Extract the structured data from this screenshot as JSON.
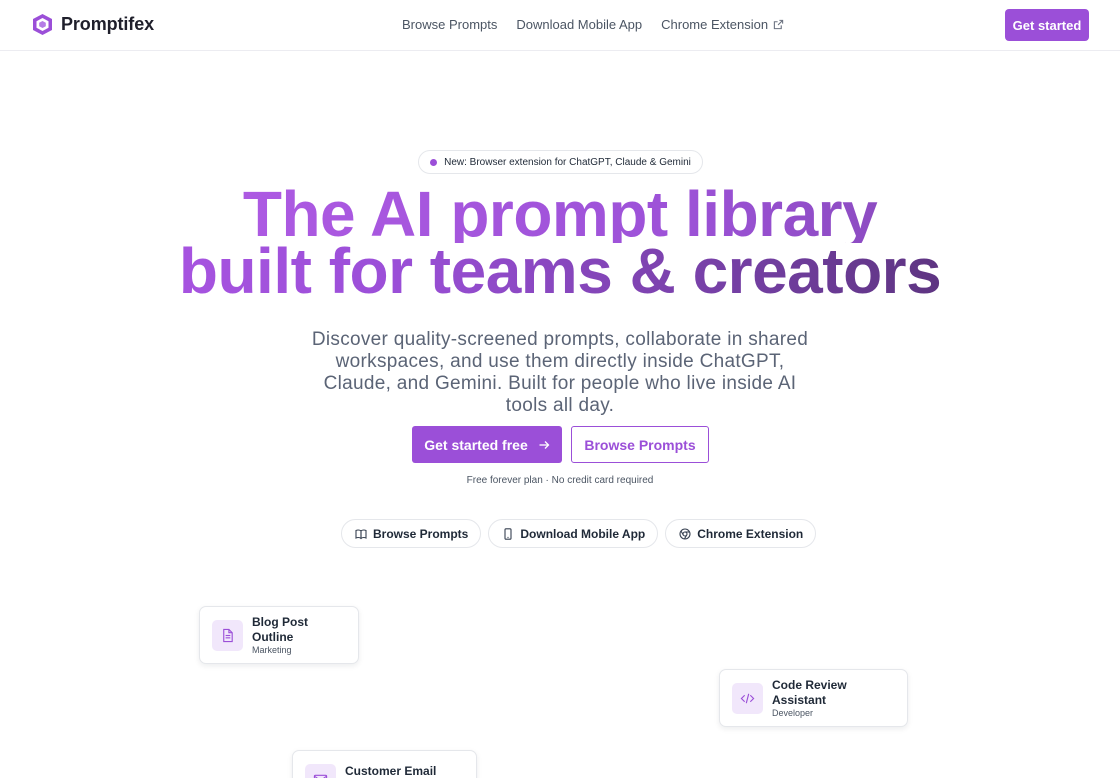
{
  "brand": {
    "name": "Promptifex",
    "accent": "#9b4fd8"
  },
  "nav": {
    "items": [
      {
        "label": "Browse Prompts"
      },
      {
        "label": "Download Mobile App"
      },
      {
        "label": "Chrome Extension",
        "icon": "external-link-icon"
      }
    ],
    "cta_label": "Get started"
  },
  "hero": {
    "badge": "New: Browser extension for ChatGPT, Claude & Gemini",
    "headline_line1": "The AI prompt library",
    "headline_line2": "built for teams & creators",
    "subtext": "Discover quality-screened prompts, collaborate in shared workspaces, and use them directly inside ChatGPT, Claude, and Gemini. Built for people who live inside AI tools all day.",
    "primary_cta": "Get started free",
    "secondary_cta": "Browse Prompts",
    "note": "Free forever plan · No credit card required"
  },
  "quick_links": [
    {
      "label": "Browse Prompts",
      "icon": "book-icon"
    },
    {
      "label": "Download Mobile App",
      "icon": "smartphone-icon"
    },
    {
      "label": "Chrome Extension",
      "icon": "chrome-icon"
    }
  ],
  "cards": [
    {
      "title": "Blog Post Outline",
      "category": "Marketing",
      "icon": "document-icon"
    },
    {
      "title": "Code Review Assistant",
      "category": "Developer",
      "icon": "code-icon"
    },
    {
      "title": "Customer Email Reply",
      "category": "",
      "icon": "mail-icon"
    }
  ]
}
